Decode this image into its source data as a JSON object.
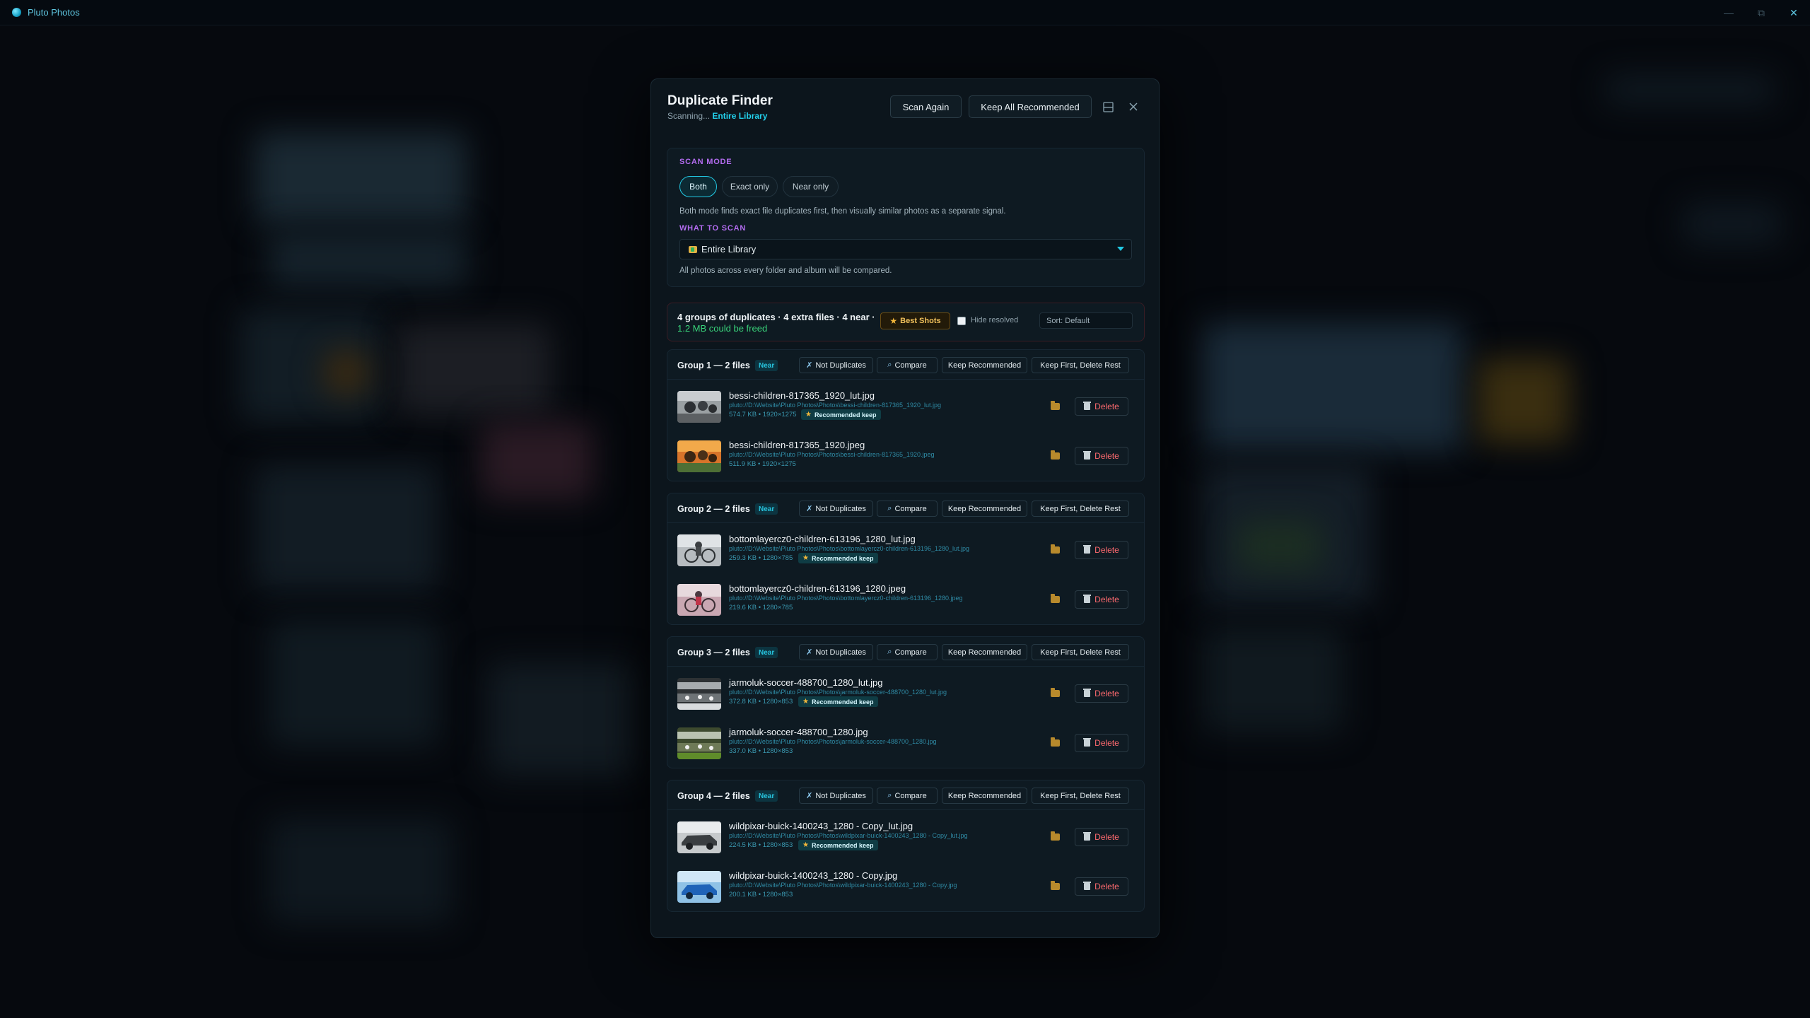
{
  "app": {
    "title": "Pluto Photos",
    "icon": "pluto-icon"
  },
  "window_controls": {
    "minimize": "—",
    "maximize": "⧉",
    "close": "✕"
  },
  "modal": {
    "title": "Duplicate Finder",
    "scanning_prefix": "Scanning... ",
    "scanning_target": "Entire Library",
    "scan_again": "Scan Again",
    "keep_all_recommended": "Keep All Recommended"
  },
  "scan_mode": {
    "label": "SCAN MODE",
    "options": [
      "Both",
      "Exact only",
      "Near only"
    ],
    "selected": "Both",
    "hint": "Both mode finds exact file duplicates first, then visually similar photos as a separate signal."
  },
  "what_to_scan": {
    "label": "WHAT TO SCAN",
    "value": "Entire Library",
    "hint": "All photos across every folder and album will be compared."
  },
  "summary": {
    "line": "4 groups of duplicates · 4 extra files · 4 near ·",
    "freed": "1.2 MB could be freed",
    "best_shots": "Best Shots",
    "hide_resolved": "Hide resolved",
    "hide_resolved_checked": false,
    "sort": "Sort: Default"
  },
  "group_actions": {
    "not_duplicates": "Not Duplicates",
    "compare": "Compare",
    "keep_recommended": "Keep Recommended",
    "keep_first": "Keep First, Delete Rest"
  },
  "labels": {
    "delete": "Delete",
    "recommended_keep": "Recommended keep",
    "near": "Near"
  },
  "groups": [
    {
      "title": "Group 1 — 2 files",
      "files": [
        {
          "name": "bessi-children-817365_1920_lut.jpg",
          "path": "pluto://D:\\Website\\Pluto Photos\\Photos\\bessi-children-817365_1920_lut.jpg",
          "meta": "574.7 KB • 1920×1275",
          "recommended": true
        },
        {
          "name": "bessi-children-817365_1920.jpeg",
          "path": "pluto://D:\\Website\\Pluto Photos\\Photos\\bessi-children-817365_1920.jpeg",
          "meta": "511.9 KB • 1920×1275",
          "recommended": false
        }
      ]
    },
    {
      "title": "Group 2 — 2 files",
      "files": [
        {
          "name": "bottomlayercz0-children-613196_1280_lut.jpg",
          "path": "pluto://D:\\Website\\Pluto Photos\\Photos\\bottomlayercz0-children-613196_1280_lut.jpg",
          "meta": "259.3 KB • 1280×785",
          "recommended": true
        },
        {
          "name": "bottomlayercz0-children-613196_1280.jpeg",
          "path": "pluto://D:\\Website\\Pluto Photos\\Photos\\bottomlayercz0-children-613196_1280.jpeg",
          "meta": "219.6 KB • 1280×785",
          "recommended": false
        }
      ]
    },
    {
      "title": "Group 3 — 2 files",
      "files": [
        {
          "name": "jarmoluk-soccer-488700_1280_lut.jpg",
          "path": "pluto://D:\\Website\\Pluto Photos\\Photos\\jarmoluk-soccer-488700_1280_lut.jpg",
          "meta": "372.8 KB • 1280×853",
          "recommended": true
        },
        {
          "name": "jarmoluk-soccer-488700_1280.jpg",
          "path": "pluto://D:\\Website\\Pluto Photos\\Photos\\jarmoluk-soccer-488700_1280.jpg",
          "meta": "337.0 KB • 1280×853",
          "recommended": false
        }
      ]
    },
    {
      "title": "Group 4 — 2 files",
      "files": [
        {
          "name": "wildpixar-buick-1400243_1280 - Copy_lut.jpg",
          "path": "pluto://D:\\Website\\Pluto Photos\\Photos\\wildpixar-buick-1400243_1280 - Copy_lut.jpg",
          "meta": "224.5 KB • 1280×853",
          "recommended": true
        },
        {
          "name": "wildpixar-buick-1400243_1280 - Copy.jpg",
          "path": "pluto://D:\\Website\\Pluto Photos\\Photos\\wildpixar-buick-1400243_1280 - Copy.jpg",
          "meta": "200.1 KB • 1280×853",
          "recommended": false
        }
      ]
    }
  ],
  "colors": {
    "accent": "#22d1ec",
    "section_label": "#b36cf0",
    "freed": "#39d37a",
    "delete": "#ff6a6f",
    "star": "#f4b73a"
  }
}
